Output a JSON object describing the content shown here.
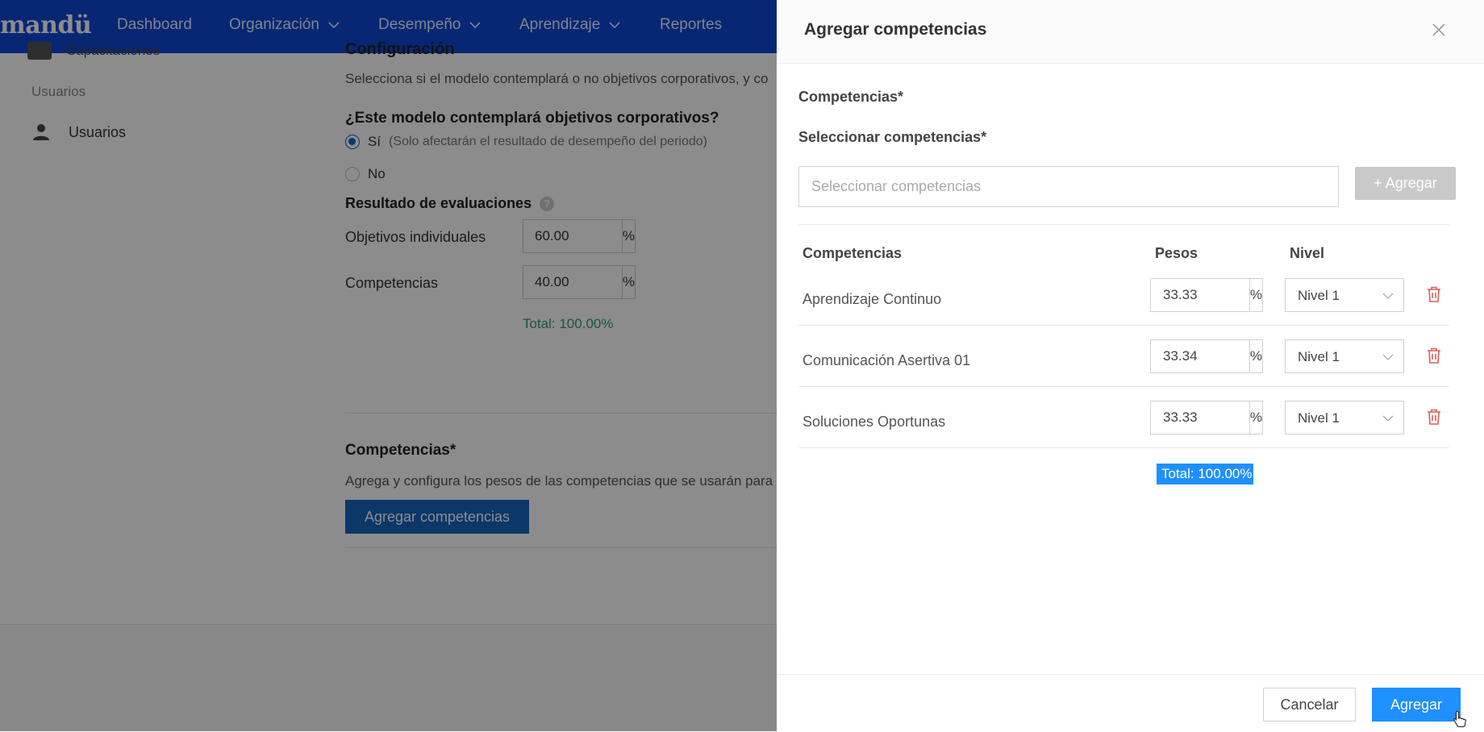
{
  "nav": {
    "brand": "mandü",
    "items": [
      {
        "label": "Dashboard",
        "dropdown": false
      },
      {
        "label": "Organización",
        "dropdown": true
      },
      {
        "label": "Desempeño",
        "dropdown": true
      },
      {
        "label": "Aprendizaje",
        "dropdown": true
      },
      {
        "label": "Reportes",
        "dropdown": false
      }
    ]
  },
  "sidebar": {
    "cut_item": "Capacitaciones",
    "section": "Usuarios",
    "item": "Usuarios"
  },
  "config": {
    "title": "Configuración",
    "description": "Selecciona si el modelo contemplará o no objetivos corporativos, y co",
    "question": "¿Este modelo contemplará objetivos corporativos?",
    "options": [
      {
        "label": "Sí",
        "hint": "(Solo afectarán el resultado de desempeño del periodo)",
        "selected": true
      },
      {
        "label": "No",
        "hint": "",
        "selected": false
      }
    ],
    "results_title": "Resultado de evaluaciones",
    "help_icon": "?",
    "results": [
      {
        "label": "Objetivos individuales",
        "value": "60.00",
        "unit": "%"
      },
      {
        "label": "Competencias",
        "value": "40.00",
        "unit": "%"
      }
    ],
    "total": "Total: 100.00%"
  },
  "competencias_section": {
    "title": "Competencias*",
    "description": "Agrega y configura los pesos de las competencias que se usarán para",
    "button": "Agregar competencias"
  },
  "drawer": {
    "title": "Agregar competencias",
    "section_label": "Competencias*",
    "select_label": "Seleccionar competencias*",
    "select_placeholder": "Seleccionar competencias",
    "add_button": "+ Agregar",
    "columns": {
      "name": "Competencias",
      "weight": "Pesos",
      "level": "Nivel"
    },
    "rows": [
      {
        "name": "Aprendizaje Continuo",
        "weight": "33.33",
        "unit": "%",
        "level": "Nivel 1"
      },
      {
        "name": "Comunicación Asertiva 01",
        "weight": "33.34",
        "unit": "%",
        "level": "Nivel 1"
      },
      {
        "name": "Soluciones Oportunas",
        "weight": "33.33",
        "unit": "%",
        "level": "Nivel 1"
      }
    ],
    "total": "Total: 100.00%",
    "cancel": "Cancelar",
    "submit": "Agregar"
  },
  "colors": {
    "nav": "#0d47d6",
    "primary": "#1e90ff",
    "total_green": "#2e9e6b",
    "trash_red": "#e05a5a"
  }
}
